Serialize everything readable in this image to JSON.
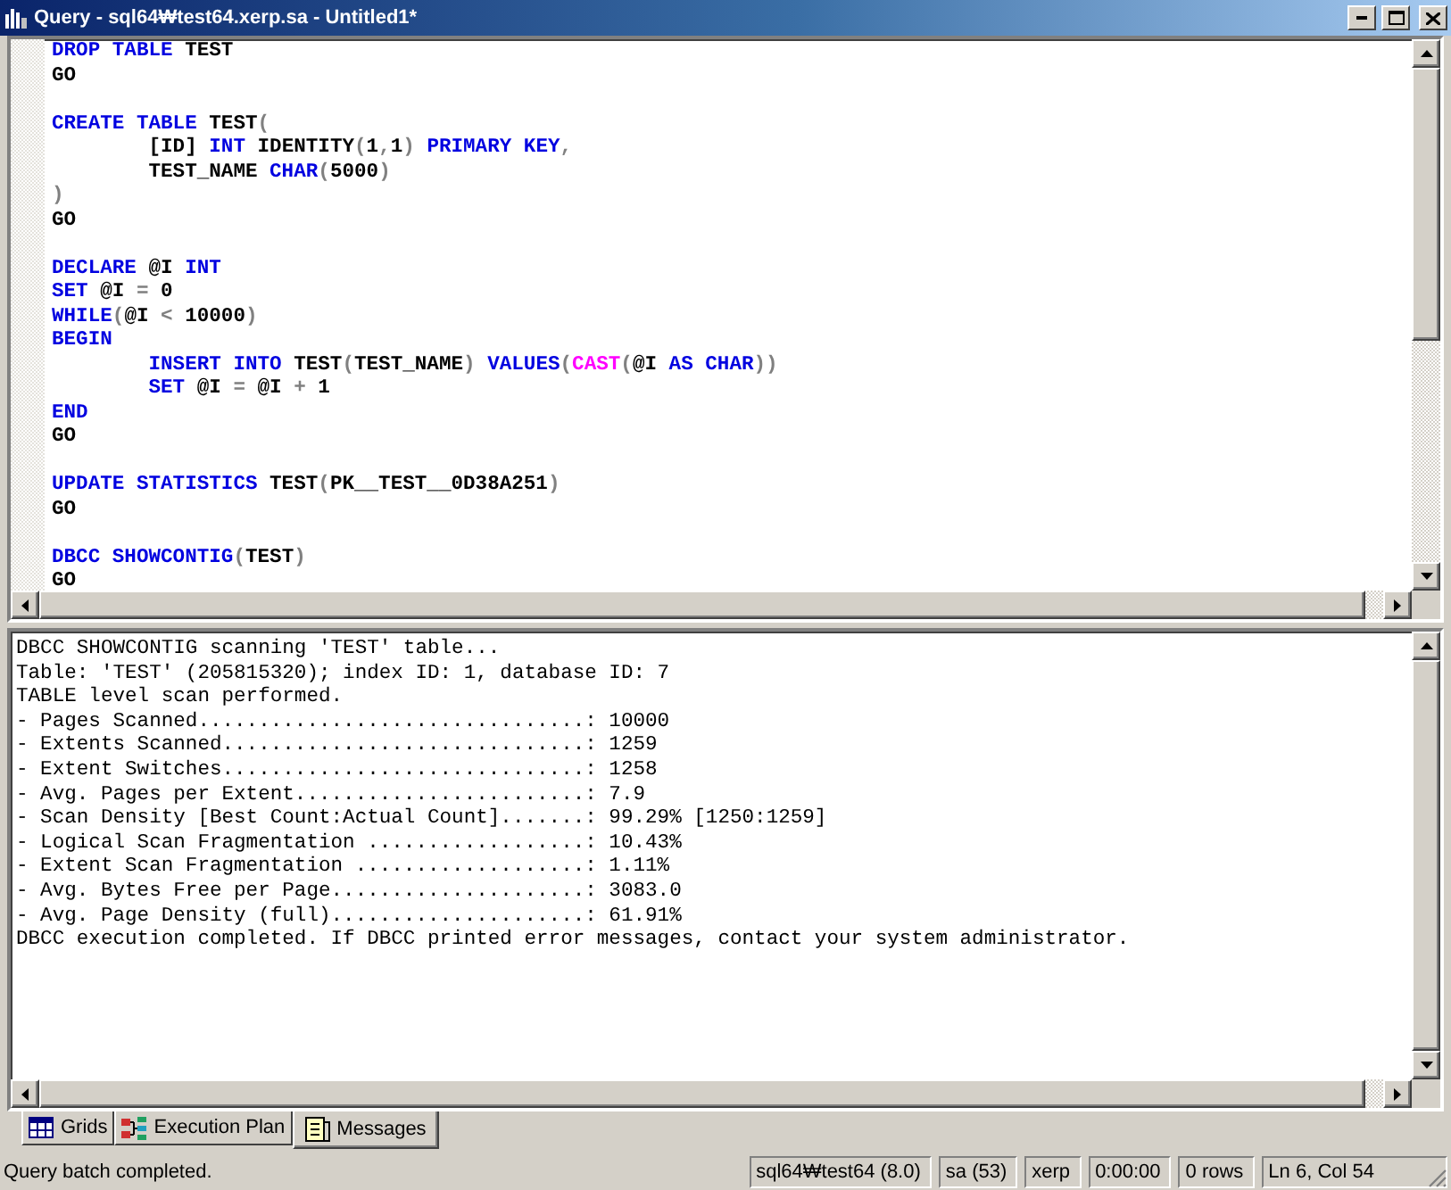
{
  "window": {
    "title": "Query - sql64₩test64.xerp.sa - Untitled1*"
  },
  "editor": {
    "lines": [
      {
        "kind": "code",
        "tokens": [
          {
            "text": "DROP TABLE",
            "kind": "keyword"
          },
          {
            "text": " TEST",
            "kind": "plain"
          }
        ]
      },
      {
        "kind": "code",
        "tokens": [
          {
            "text": "GO",
            "kind": "plain"
          }
        ]
      },
      {
        "kind": "blank"
      },
      {
        "kind": "code",
        "tokens": [
          {
            "text": "CREATE TABLE",
            "kind": "keyword"
          },
          {
            "text": " TEST",
            "kind": "plain"
          },
          {
            "text": "(",
            "kind": "operator"
          }
        ]
      },
      {
        "kind": "code",
        "tokens": [
          {
            "text": "        [ID] ",
            "kind": "plain"
          },
          {
            "text": "INT",
            "kind": "keyword"
          },
          {
            "text": " IDENTITY",
            "kind": "plain"
          },
          {
            "text": "(",
            "kind": "operator"
          },
          {
            "text": "1",
            "kind": "plain"
          },
          {
            "text": ",",
            "kind": "operator"
          },
          {
            "text": "1",
            "kind": "plain"
          },
          {
            "text": ") ",
            "kind": "operator"
          },
          {
            "text": "PRIMARY KEY",
            "kind": "keyword"
          },
          {
            "text": ",",
            "kind": "operator"
          }
        ]
      },
      {
        "kind": "code",
        "tokens": [
          {
            "text": "        TEST_NAME ",
            "kind": "plain"
          },
          {
            "text": "CHAR",
            "kind": "keyword"
          },
          {
            "text": "(",
            "kind": "operator"
          },
          {
            "text": "5000",
            "kind": "plain"
          },
          {
            "text": ")",
            "kind": "operator"
          }
        ]
      },
      {
        "kind": "code",
        "tokens": [
          {
            "text": ")",
            "kind": "operator"
          }
        ]
      },
      {
        "kind": "code",
        "tokens": [
          {
            "text": "GO",
            "kind": "plain"
          }
        ]
      },
      {
        "kind": "blank"
      },
      {
        "kind": "code",
        "tokens": [
          {
            "text": "DECLARE",
            "kind": "keyword"
          },
          {
            "text": " @I ",
            "kind": "plain"
          },
          {
            "text": "INT",
            "kind": "keyword"
          }
        ]
      },
      {
        "kind": "code",
        "tokens": [
          {
            "text": "SET",
            "kind": "keyword"
          },
          {
            "text": " @I ",
            "kind": "plain"
          },
          {
            "text": "=",
            "kind": "operator"
          },
          {
            "text": " 0",
            "kind": "plain"
          }
        ]
      },
      {
        "kind": "code",
        "tokens": [
          {
            "text": "WHILE",
            "kind": "keyword"
          },
          {
            "text": "(",
            "kind": "operator"
          },
          {
            "text": "@I ",
            "kind": "plain"
          },
          {
            "text": "<",
            "kind": "operator"
          },
          {
            "text": " 10000",
            "kind": "plain"
          },
          {
            "text": ")",
            "kind": "operator"
          }
        ]
      },
      {
        "kind": "code",
        "tokens": [
          {
            "text": "BEGIN",
            "kind": "keyword"
          }
        ]
      },
      {
        "kind": "code",
        "tokens": [
          {
            "text": "        INSERT INTO",
            "kind": "keyword"
          },
          {
            "text": " TEST",
            "kind": "plain"
          },
          {
            "text": "(",
            "kind": "operator"
          },
          {
            "text": "TEST_NAME",
            "kind": "plain"
          },
          {
            "text": ") ",
            "kind": "operator"
          },
          {
            "text": "VALUES",
            "kind": "keyword"
          },
          {
            "text": "(",
            "kind": "operator"
          },
          {
            "text": "CAST",
            "kind": "function"
          },
          {
            "text": "(",
            "kind": "operator"
          },
          {
            "text": "@I ",
            "kind": "plain"
          },
          {
            "text": "AS CHAR",
            "kind": "keyword"
          },
          {
            "text": "))",
            "kind": "operator"
          }
        ]
      },
      {
        "kind": "code",
        "tokens": [
          {
            "text": "        SET",
            "kind": "keyword"
          },
          {
            "text": " @I ",
            "kind": "plain"
          },
          {
            "text": "=",
            "kind": "operator"
          },
          {
            "text": " @I ",
            "kind": "plain"
          },
          {
            "text": "+",
            "kind": "operator"
          },
          {
            "text": " 1",
            "kind": "plain"
          }
        ]
      },
      {
        "kind": "code",
        "tokens": [
          {
            "text": "END",
            "kind": "keyword"
          }
        ]
      },
      {
        "kind": "code",
        "tokens": [
          {
            "text": "GO",
            "kind": "plain"
          }
        ]
      },
      {
        "kind": "blank"
      },
      {
        "kind": "code",
        "tokens": [
          {
            "text": "UPDATE STATISTICS",
            "kind": "keyword"
          },
          {
            "text": " TEST",
            "kind": "plain"
          },
          {
            "text": "(",
            "kind": "operator"
          },
          {
            "text": "PK__TEST__0D38A251",
            "kind": "plain"
          },
          {
            "text": ")",
            "kind": "operator"
          }
        ]
      },
      {
        "kind": "code",
        "tokens": [
          {
            "text": "GO",
            "kind": "plain"
          }
        ]
      },
      {
        "kind": "blank"
      },
      {
        "kind": "code",
        "tokens": [
          {
            "text": "DBCC SHOWCONTIG",
            "kind": "keyword"
          },
          {
            "text": "(",
            "kind": "operator"
          },
          {
            "text": "TEST",
            "kind": "plain"
          },
          {
            "text": ")",
            "kind": "operator"
          }
        ]
      },
      {
        "kind": "code",
        "tokens": [
          {
            "text": "GO",
            "kind": "plain"
          }
        ]
      }
    ]
  },
  "messages": {
    "lines": [
      "DBCC SHOWCONTIG scanning 'TEST' table...",
      "Table: 'TEST' (205815320); index ID: 1, database ID: 7",
      "TABLE level scan performed.",
      "- Pages Scanned................................: 10000",
      "- Extents Scanned..............................: 1259",
      "- Extent Switches..............................: 1258",
      "- Avg. Pages per Extent........................: 7.9",
      "- Scan Density [Best Count:Actual Count].......: 99.29% [1250:1259]",
      "- Logical Scan Fragmentation ..................: 10.43%",
      "- Extent Scan Fragmentation ...................: 1.11%",
      "- Avg. Bytes Free per Page.....................: 3083.0",
      "- Avg. Page Density (full).....................: 61.91%",
      "DBCC execution completed. If DBCC printed error messages, contact your system administrator."
    ]
  },
  "result_tabs": [
    {
      "label": "Grids",
      "kind": "grid",
      "selected": false
    },
    {
      "label": "Execution Plan",
      "kind": "plan",
      "selected": false
    },
    {
      "label": "Messages",
      "kind": "messages",
      "selected": true
    }
  ],
  "status_bar": {
    "message": "Query batch completed.",
    "panels": [
      "sql64₩test64 (8.0)",
      "sa (53)",
      "xerp",
      "0:00:00",
      "0 rows",
      "Ln 6, Col 54"
    ]
  }
}
